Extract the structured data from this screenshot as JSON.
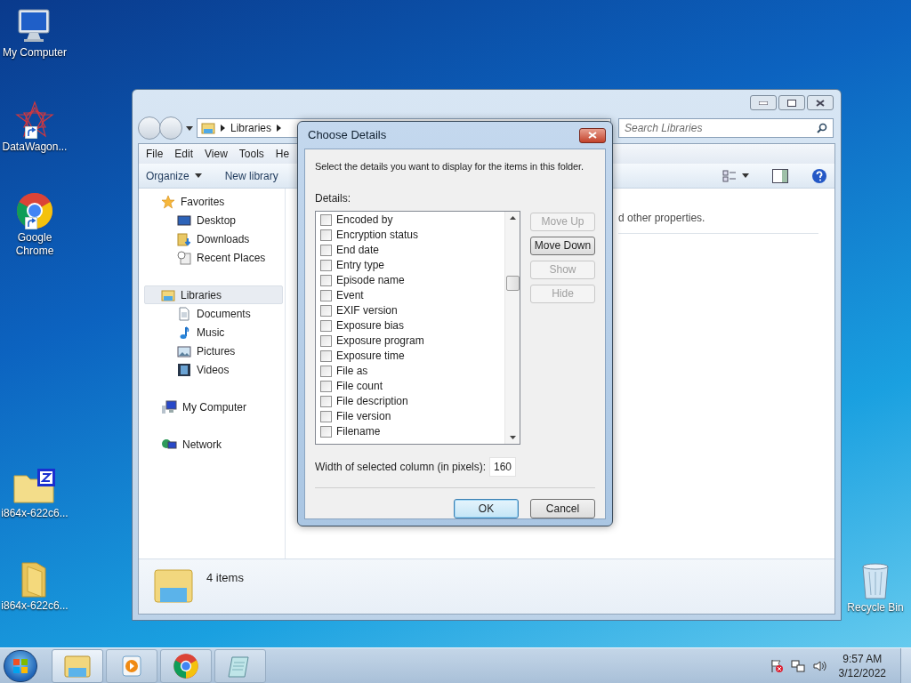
{
  "desktop_icons": [
    {
      "label": "My Computer",
      "kind": "computer",
      "shortcut": false
    },
    {
      "label": "DataWagon...",
      "kind": "star",
      "shortcut": true
    },
    {
      "label": "Google Chrome",
      "kind": "chrome",
      "shortcut": true
    },
    {
      "label": "i864x-622c6...",
      "kind": "zip-folder",
      "shortcut": false
    },
    {
      "label": "i864x-622c6...",
      "kind": "folder",
      "shortcut": false
    },
    {
      "label": "Recycle Bin",
      "kind": "bin",
      "shortcut": false
    }
  ],
  "explorer": {
    "address": [
      "Libraries"
    ],
    "search_placeholder": "Search Libraries",
    "menu": [
      "File",
      "Edit",
      "View",
      "Tools",
      "He"
    ],
    "toolbar": [
      "Organize",
      "New library"
    ],
    "nav": [
      {
        "label": "Favorites",
        "kind": "star",
        "selected": false,
        "children": [
          {
            "label": "Desktop",
            "kind": "desktop",
            "selected": false
          },
          {
            "label": "Downloads",
            "kind": "downloads",
            "selected": false
          },
          {
            "label": "Recent Places",
            "kind": "recent",
            "selected": false
          }
        ]
      },
      {
        "label": "Libraries",
        "kind": "library",
        "selected": true,
        "children": [
          {
            "label": "Documents",
            "kind": "document",
            "selected": false
          },
          {
            "label": "Music",
            "kind": "music",
            "selected": false
          },
          {
            "label": "Pictures",
            "kind": "picture",
            "selected": false
          },
          {
            "label": "Videos",
            "kind": "video",
            "selected": false
          }
        ]
      },
      {
        "label": "My Computer",
        "kind": "computer",
        "selected": false
      },
      {
        "label": "Network",
        "kind": "network",
        "selected": false
      }
    ],
    "content_text": "d other properties.",
    "status": "4 items"
  },
  "dialog": {
    "title": "Choose Details",
    "instruction": "Select the details you want to display for the items in this folder.",
    "list_label": "Details:",
    "details": [
      {
        "label": "Encoded by",
        "checked": false
      },
      {
        "label": "Encryption status",
        "checked": false
      },
      {
        "label": "End date",
        "checked": false
      },
      {
        "label": "Entry type",
        "checked": false
      },
      {
        "label": "Episode name",
        "checked": false
      },
      {
        "label": "Event",
        "checked": false
      },
      {
        "label": "EXIF version",
        "checked": false
      },
      {
        "label": "Exposure bias",
        "checked": false
      },
      {
        "label": "Exposure program",
        "checked": false
      },
      {
        "label": "Exposure time",
        "checked": false
      },
      {
        "label": "File as",
        "checked": false
      },
      {
        "label": "File count",
        "checked": false
      },
      {
        "label": "File description",
        "checked": false
      },
      {
        "label": "File version",
        "checked": false
      },
      {
        "label": "Filename",
        "checked": false
      }
    ],
    "side_buttons": [
      {
        "label": "Move Up",
        "disabled": true
      },
      {
        "label": "Move Down",
        "disabled": false
      },
      {
        "label": "Show",
        "disabled": true
      },
      {
        "label": "Hide",
        "disabled": true
      }
    ],
    "width_label": "Width of selected column (in pixels):",
    "width_value": "160",
    "actions": [
      {
        "label": "OK",
        "default": true
      },
      {
        "label": "Cancel",
        "default": false
      }
    ]
  },
  "taskbar": {
    "apps": [
      {
        "kind": "explorer",
        "selected": true
      },
      {
        "kind": "media",
        "selected": false
      },
      {
        "kind": "chrome",
        "selected": false
      },
      {
        "kind": "notepad",
        "selected": false
      }
    ],
    "time": "9:57 AM",
    "date": "3/12/2022"
  }
}
